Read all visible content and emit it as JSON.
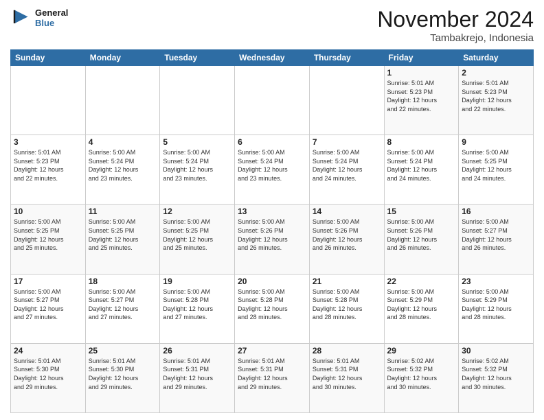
{
  "logo": {
    "line1": "General",
    "line2": "Blue"
  },
  "title": "November 2024",
  "location": "Tambakrejo, Indonesia",
  "days_of_week": [
    "Sunday",
    "Monday",
    "Tuesday",
    "Wednesday",
    "Thursday",
    "Friday",
    "Saturday"
  ],
  "weeks": [
    [
      {
        "day": "",
        "info": ""
      },
      {
        "day": "",
        "info": ""
      },
      {
        "day": "",
        "info": ""
      },
      {
        "day": "",
        "info": ""
      },
      {
        "day": "",
        "info": ""
      },
      {
        "day": "1",
        "info": "Sunrise: 5:01 AM\nSunset: 5:23 PM\nDaylight: 12 hours\nand 22 minutes."
      },
      {
        "day": "2",
        "info": "Sunrise: 5:01 AM\nSunset: 5:23 PM\nDaylight: 12 hours\nand 22 minutes."
      }
    ],
    [
      {
        "day": "3",
        "info": "Sunrise: 5:01 AM\nSunset: 5:23 PM\nDaylight: 12 hours\nand 22 minutes."
      },
      {
        "day": "4",
        "info": "Sunrise: 5:00 AM\nSunset: 5:24 PM\nDaylight: 12 hours\nand 23 minutes."
      },
      {
        "day": "5",
        "info": "Sunrise: 5:00 AM\nSunset: 5:24 PM\nDaylight: 12 hours\nand 23 minutes."
      },
      {
        "day": "6",
        "info": "Sunrise: 5:00 AM\nSunset: 5:24 PM\nDaylight: 12 hours\nand 23 minutes."
      },
      {
        "day": "7",
        "info": "Sunrise: 5:00 AM\nSunset: 5:24 PM\nDaylight: 12 hours\nand 24 minutes."
      },
      {
        "day": "8",
        "info": "Sunrise: 5:00 AM\nSunset: 5:24 PM\nDaylight: 12 hours\nand 24 minutes."
      },
      {
        "day": "9",
        "info": "Sunrise: 5:00 AM\nSunset: 5:25 PM\nDaylight: 12 hours\nand 24 minutes."
      }
    ],
    [
      {
        "day": "10",
        "info": "Sunrise: 5:00 AM\nSunset: 5:25 PM\nDaylight: 12 hours\nand 25 minutes."
      },
      {
        "day": "11",
        "info": "Sunrise: 5:00 AM\nSunset: 5:25 PM\nDaylight: 12 hours\nand 25 minutes."
      },
      {
        "day": "12",
        "info": "Sunrise: 5:00 AM\nSunset: 5:25 PM\nDaylight: 12 hours\nand 25 minutes."
      },
      {
        "day": "13",
        "info": "Sunrise: 5:00 AM\nSunset: 5:26 PM\nDaylight: 12 hours\nand 26 minutes."
      },
      {
        "day": "14",
        "info": "Sunrise: 5:00 AM\nSunset: 5:26 PM\nDaylight: 12 hours\nand 26 minutes."
      },
      {
        "day": "15",
        "info": "Sunrise: 5:00 AM\nSunset: 5:26 PM\nDaylight: 12 hours\nand 26 minutes."
      },
      {
        "day": "16",
        "info": "Sunrise: 5:00 AM\nSunset: 5:27 PM\nDaylight: 12 hours\nand 26 minutes."
      }
    ],
    [
      {
        "day": "17",
        "info": "Sunrise: 5:00 AM\nSunset: 5:27 PM\nDaylight: 12 hours\nand 27 minutes."
      },
      {
        "day": "18",
        "info": "Sunrise: 5:00 AM\nSunset: 5:27 PM\nDaylight: 12 hours\nand 27 minutes."
      },
      {
        "day": "19",
        "info": "Sunrise: 5:00 AM\nSunset: 5:28 PM\nDaylight: 12 hours\nand 27 minutes."
      },
      {
        "day": "20",
        "info": "Sunrise: 5:00 AM\nSunset: 5:28 PM\nDaylight: 12 hours\nand 28 minutes."
      },
      {
        "day": "21",
        "info": "Sunrise: 5:00 AM\nSunset: 5:28 PM\nDaylight: 12 hours\nand 28 minutes."
      },
      {
        "day": "22",
        "info": "Sunrise: 5:00 AM\nSunset: 5:29 PM\nDaylight: 12 hours\nand 28 minutes."
      },
      {
        "day": "23",
        "info": "Sunrise: 5:00 AM\nSunset: 5:29 PM\nDaylight: 12 hours\nand 28 minutes."
      }
    ],
    [
      {
        "day": "24",
        "info": "Sunrise: 5:01 AM\nSunset: 5:30 PM\nDaylight: 12 hours\nand 29 minutes."
      },
      {
        "day": "25",
        "info": "Sunrise: 5:01 AM\nSunset: 5:30 PM\nDaylight: 12 hours\nand 29 minutes."
      },
      {
        "day": "26",
        "info": "Sunrise: 5:01 AM\nSunset: 5:31 PM\nDaylight: 12 hours\nand 29 minutes."
      },
      {
        "day": "27",
        "info": "Sunrise: 5:01 AM\nSunset: 5:31 PM\nDaylight: 12 hours\nand 29 minutes."
      },
      {
        "day": "28",
        "info": "Sunrise: 5:01 AM\nSunset: 5:31 PM\nDaylight: 12 hours\nand 30 minutes."
      },
      {
        "day": "29",
        "info": "Sunrise: 5:02 AM\nSunset: 5:32 PM\nDaylight: 12 hours\nand 30 minutes."
      },
      {
        "day": "30",
        "info": "Sunrise: 5:02 AM\nSunset: 5:32 PM\nDaylight: 12 hours\nand 30 minutes."
      }
    ]
  ]
}
